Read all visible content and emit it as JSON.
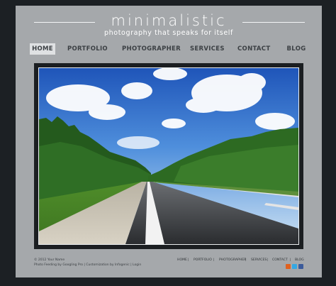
{
  "site": {
    "title": "minimalistic",
    "tagline": "photography that speaks for itself"
  },
  "nav": {
    "items": [
      {
        "label": "HOME",
        "active": true
      },
      {
        "label": "PORTFOLIO",
        "active": false
      },
      {
        "label": "PHOTOGRAPHER",
        "active": false
      },
      {
        "label": "SERVICES",
        "active": false
      },
      {
        "label": "CONTACT",
        "active": false
      },
      {
        "label": "BLOG",
        "active": false
      }
    ]
  },
  "hero": {
    "subject": "open road"
  },
  "footer": {
    "copyright": "© 2012 Your Name",
    "credits": "Photo Feeding by Googling Pro | Customization by Infogenic | Login",
    "nav": [
      "HOME",
      "PORTFOLIO",
      "PHOTOGRAPHER",
      "SERVICES",
      "CONTACT",
      "BLOG"
    ],
    "separator": "|",
    "social": [
      {
        "name": "rss-icon",
        "color": "#e0611f"
      },
      {
        "name": "twitter-icon",
        "color": "#35a8e3"
      },
      {
        "name": "facebook-icon",
        "color": "#3b5a9a"
      }
    ]
  },
  "colors": {
    "page_bg": "#1c2024",
    "panel": "#a5a8ab",
    "active_nav": "#dfe1e3"
  }
}
